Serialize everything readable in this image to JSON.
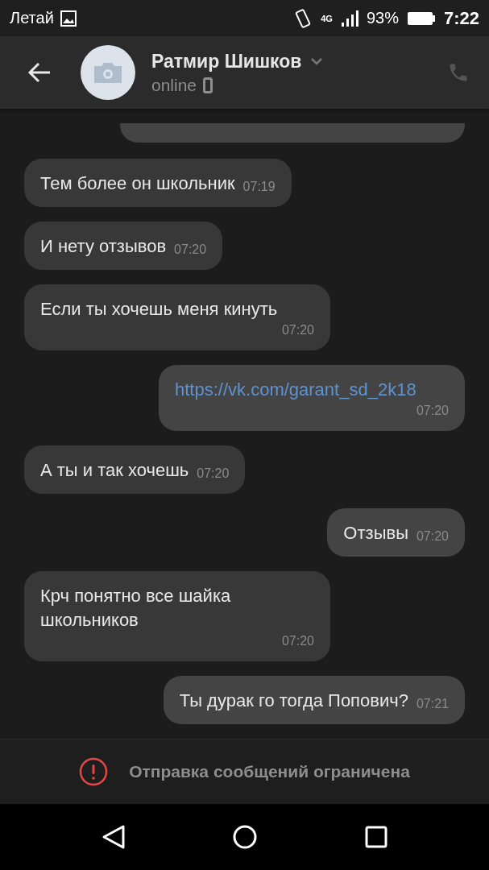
{
  "status_bar": {
    "carrier": "Летай",
    "network": "4G",
    "battery": "93%",
    "time": "7:22"
  },
  "header": {
    "name": "Ратмир Шишков",
    "status": "online"
  },
  "messages": [
    {
      "kind": "partial",
      "outgoing": true
    },
    {
      "kind": "text",
      "outgoing": false,
      "text": "Тем более он школьник",
      "time": "07:19"
    },
    {
      "kind": "text",
      "outgoing": false,
      "text": "И нету отзывов",
      "time": "07:20"
    },
    {
      "kind": "text",
      "outgoing": false,
      "text": "Если ты хочешь меня кинуть",
      "time": "07:20"
    },
    {
      "kind": "link",
      "outgoing": true,
      "text": "https://vk.com/garant_sd_2k18",
      "time": "07:20"
    },
    {
      "kind": "text",
      "outgoing": false,
      "text": "А ты и так хочешь",
      "time": "07:20"
    },
    {
      "kind": "text",
      "outgoing": true,
      "text": "Отзывы",
      "time": "07:20"
    },
    {
      "kind": "text",
      "outgoing": false,
      "text": "Крч понятно все шайка школьников",
      "time": "07:20"
    },
    {
      "kind": "text",
      "outgoing": true,
      "text": "Ты дурак го тогда Попович?",
      "time": "07:21"
    }
  ],
  "notice": "Отправка сообщений ограничена"
}
